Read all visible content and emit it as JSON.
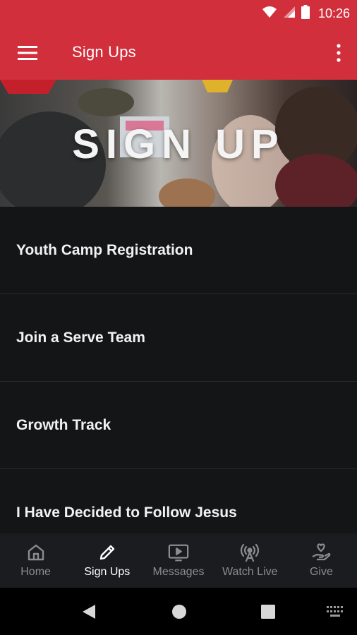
{
  "status_bar": {
    "time": "10:26",
    "icons": [
      "wifi-icon",
      "signal-icon",
      "battery-icon"
    ]
  },
  "app_bar": {
    "title": "Sign Ups",
    "menu_icon": "hamburger-menu-icon",
    "overflow_icon": "more-vertical-icon",
    "background_color": "#d12f3c"
  },
  "hero": {
    "title": "SIGN UP"
  },
  "sign_up_list": {
    "items": [
      {
        "label": "Youth Camp Registration"
      },
      {
        "label": "Join a Serve Team"
      },
      {
        "label": "Growth Track"
      },
      {
        "label": "I Have Decided to Follow Jesus"
      }
    ]
  },
  "bottom_nav": {
    "active": "Sign Ups",
    "items": [
      {
        "label": "Home",
        "icon": "home-icon"
      },
      {
        "label": "Sign Ups",
        "icon": "pencil-icon"
      },
      {
        "label": "Messages",
        "icon": "tv-play-icon"
      },
      {
        "label": "Watch Live",
        "icon": "broadcast-antenna-icon"
      },
      {
        "label": "Give",
        "icon": "hand-heart-icon"
      }
    ]
  },
  "system_nav": {
    "buttons": [
      "back-icon",
      "home-circle-icon",
      "recents-square-icon",
      "keyboard-icon"
    ]
  }
}
